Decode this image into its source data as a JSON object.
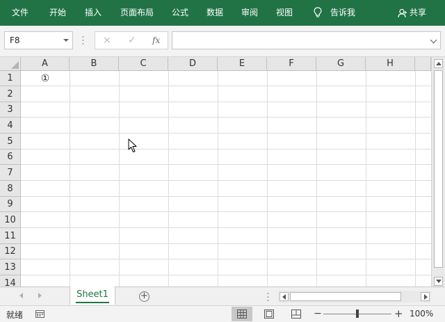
{
  "ribbon": {
    "tabs": [
      "文件",
      "开始",
      "插入",
      "页面布局",
      "公式",
      "数据",
      "审阅",
      "视图"
    ],
    "tell_me": "告诉我",
    "share": "共享",
    "accent_color": "#217346"
  },
  "formula_bar": {
    "name_box": "F8",
    "cancel_icon": "×",
    "enter_icon": "✓",
    "function_icon": "fx",
    "formula_value": ""
  },
  "grid": {
    "columns": [
      "A",
      "B",
      "C",
      "D",
      "E",
      "F",
      "G",
      "H"
    ],
    "rows": [
      "1",
      "2",
      "3",
      "4",
      "5",
      "6",
      "7",
      "8",
      "9",
      "10",
      "11",
      "12",
      "13",
      "14"
    ],
    "cell_a1": "①"
  },
  "sheets": {
    "tabs": [
      "Sheet1"
    ],
    "add_icon": "⊕"
  },
  "status_bar": {
    "ready": "就绪",
    "zoom_minus": "−",
    "zoom_plus": "+",
    "zoom": "100%",
    "zoom_level": 100
  }
}
